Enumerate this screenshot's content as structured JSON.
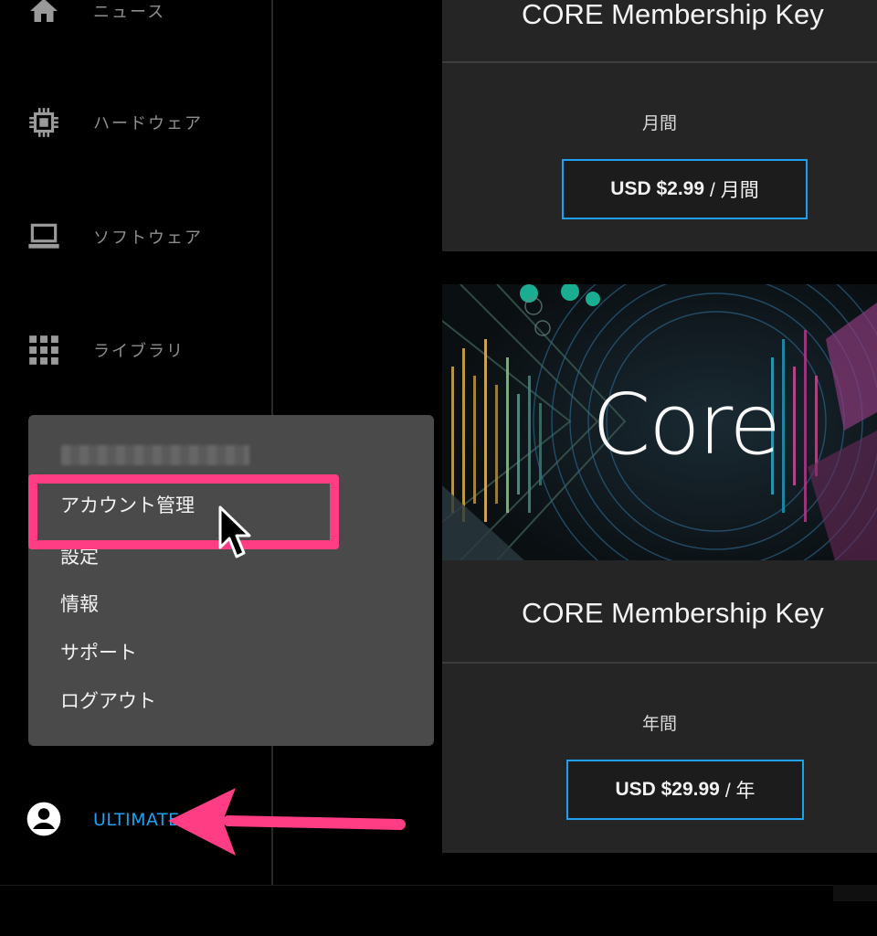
{
  "sidebar": {
    "items": [
      {
        "label": "ニュース",
        "icon": "home-icon"
      },
      {
        "label": "ハードウェア",
        "icon": "chip-icon"
      },
      {
        "label": "ソフトウェア",
        "icon": "laptop-icon"
      },
      {
        "label": "ライブラリ",
        "icon": "grid-icon"
      }
    ]
  },
  "popup_menu": {
    "items": [
      "アカウント管理",
      "設定",
      "情報",
      "サポート",
      "ログアウト"
    ]
  },
  "account": {
    "label": "ULTIMATE",
    "icon": "account-circle-icon"
  },
  "products": [
    {
      "title": "CORE Membership Key",
      "period": "月間",
      "price": "USD $2.99",
      "price_unit": "/ 月間"
    },
    {
      "title": "CORE Membership Key",
      "period": "年間",
      "price": "USD $29.99",
      "price_unit": "/ 年"
    }
  ],
  "banner": {
    "text": "Core"
  },
  "colors": {
    "accent_blue": "#1e9ff0",
    "highlight_pink": "#ff3d84",
    "background": "#000000",
    "card": "#252525",
    "popup": "#4a4a4a"
  }
}
